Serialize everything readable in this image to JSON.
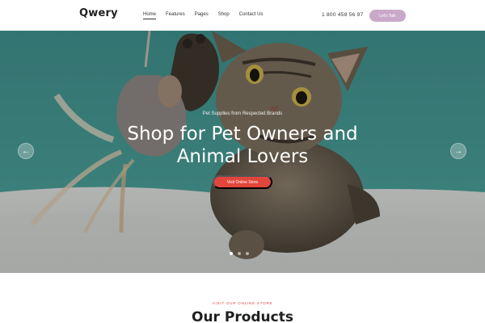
{
  "brand": {
    "logo": "Qwery"
  },
  "nav": {
    "items": [
      {
        "label": "Home",
        "active": true
      },
      {
        "label": "Features",
        "active": false
      },
      {
        "label": "Pages",
        "active": false
      },
      {
        "label": "Shop",
        "active": false
      },
      {
        "label": "Contact Us",
        "active": false
      }
    ]
  },
  "header": {
    "phone": "1 800 458 56 97",
    "cta_label": "Let's Talk"
  },
  "hero": {
    "eyebrow": "Pet Supplies from Respected Brands",
    "headline_line1": "Shop for Pet Owners and",
    "headline_line2": "Animal Lovers",
    "button_label": "Visit Online Store",
    "prev_icon": "arrow-left-icon",
    "next_icon": "arrow-right-icon",
    "slides": [
      {
        "active": true
      },
      {
        "active": false
      },
      {
        "active": false
      }
    ]
  },
  "products": {
    "eyebrow": "VISIT OUR ONLINE STORE",
    "title": "Our Products"
  },
  "colors": {
    "accent": "#e2453b",
    "cta": "#c9a9c9",
    "hero_bg": "#3f8f8a"
  }
}
